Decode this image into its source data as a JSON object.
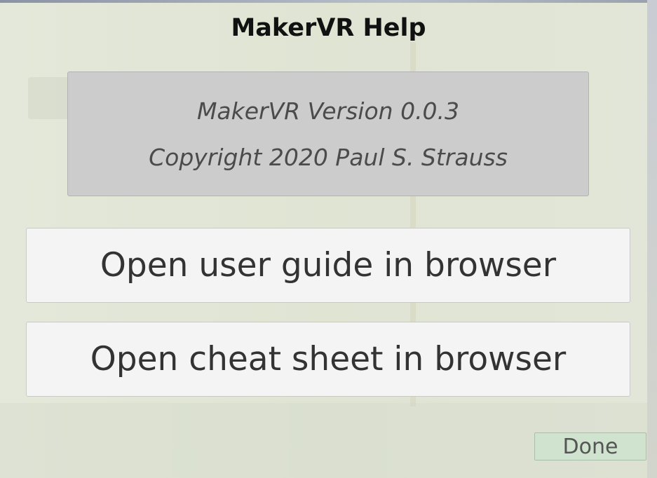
{
  "dialog": {
    "title": "MakerVR Help",
    "info": {
      "version": "MakerVR Version 0.0.3",
      "copyright": "Copyright 2020 Paul S. Strauss"
    },
    "buttons": {
      "user_guide": "Open user guide in browser",
      "cheat_sheet": "Open cheat sheet in browser",
      "done": "Done"
    }
  },
  "colors": {
    "panel_background": "#dde3d2",
    "info_box": "#cbcccb",
    "button_background": "#f4f4f4",
    "done_button": "#cfe3cf"
  }
}
